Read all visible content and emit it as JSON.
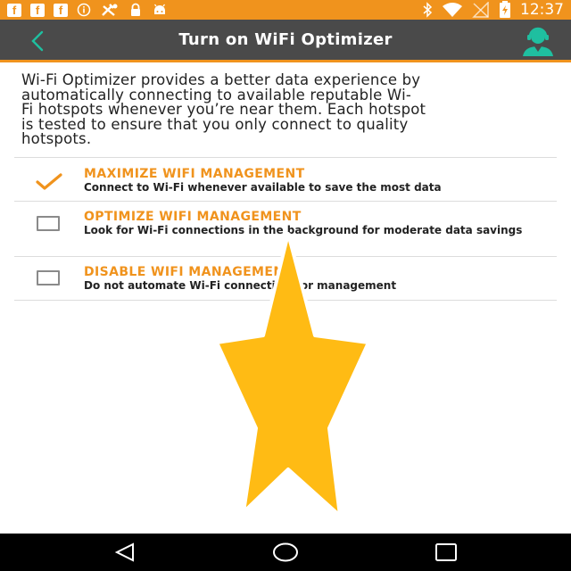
{
  "status_bar": {
    "left_icons": [
      "facebook-icon",
      "facebook-icon",
      "facebook-icon",
      "info-icon",
      "tools-icon",
      "lock-icon",
      "android-icon"
    ],
    "right_icons": [
      "bluetooth-icon",
      "wifi-icon",
      "no-signal-icon",
      "battery-charging-icon"
    ],
    "time": "12:37",
    "background_color": "#f0931d"
  },
  "app_bar": {
    "title": "Turn on WiFi Optimizer",
    "back_icon": "chevron-left-icon",
    "support_icon": "support-agent-icon",
    "background_color": "#4a4a4a",
    "accent_color": "#f0931d",
    "back_icon_color": "#1fbfa0",
    "support_icon_color": "#1fbfa0"
  },
  "intro": {
    "lines": [
      "Wi-Fi Optimizer provides a better data experience by",
      "automatically connecting to available reputable Wi-",
      "Fi hotspots whenever you’re near them. Each hotspot",
      "is tested to ensure that you only connect to quality",
      "hotspots."
    ]
  },
  "options": [
    {
      "title": "MAXIMIZE WIFI MANAGEMENT",
      "description": "Connect to Wi-Fi whenever available to save the most data",
      "selected": true
    },
    {
      "title": "OPTIMIZE WIFI MANAGEMENT",
      "description": "Look for Wi-Fi connections in the background for moderate data savings",
      "selected": false
    },
    {
      "title": "DISABLE WIFI MANAGEMENT",
      "description": "Do not automate Wi-Fi connections or management",
      "selected": false
    }
  ],
  "overlay": {
    "shape": "star-icon",
    "color": "#ffbb14"
  },
  "nav_bar": {
    "buttons": [
      "back-triangle-icon",
      "home-circle-icon",
      "recents-square-icon"
    ]
  }
}
